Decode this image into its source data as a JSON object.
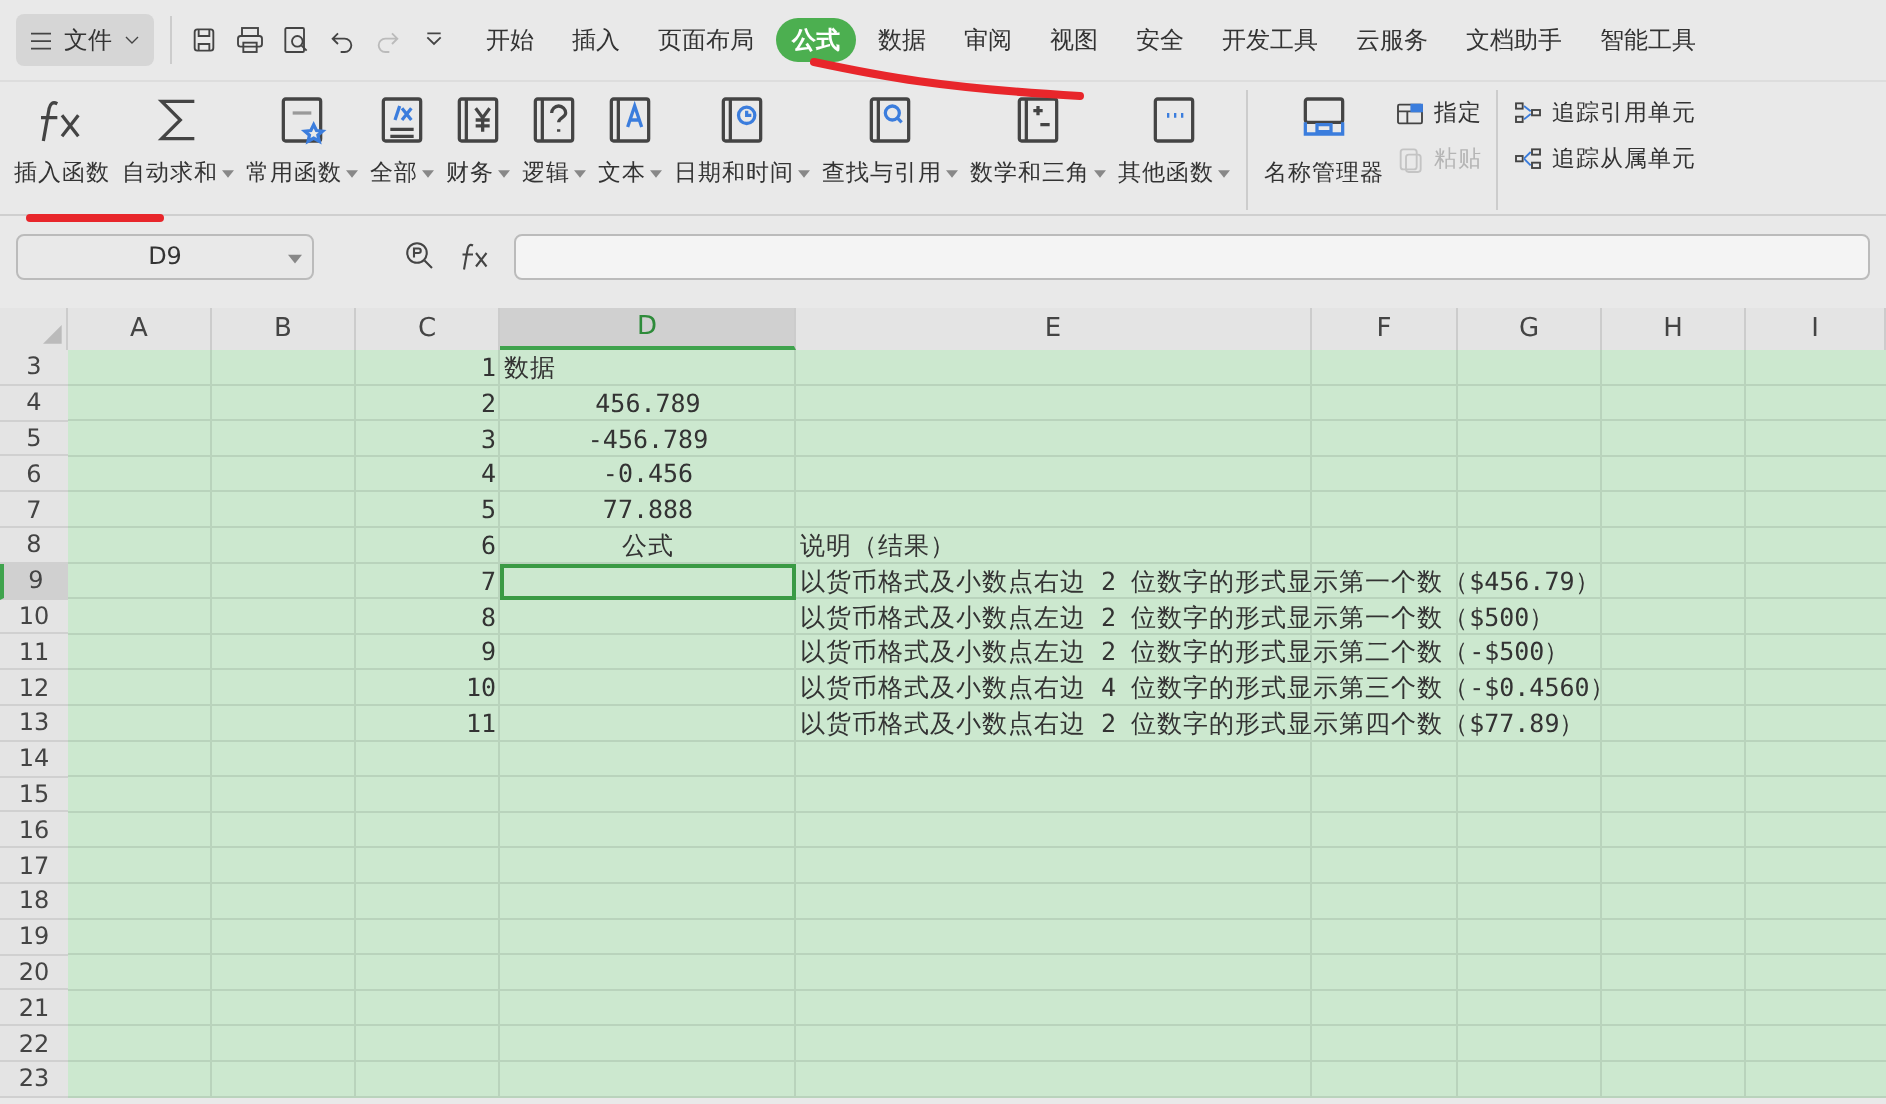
{
  "menu_button": {
    "label": "文件"
  },
  "tabs": [
    {
      "label": "开始",
      "selected": false
    },
    {
      "label": "插入",
      "selected": false
    },
    {
      "label": "页面布局",
      "selected": false
    },
    {
      "label": "公式",
      "selected": true
    },
    {
      "label": "数据",
      "selected": false
    },
    {
      "label": "审阅",
      "selected": false
    },
    {
      "label": "视图",
      "selected": false
    },
    {
      "label": "安全",
      "selected": false
    },
    {
      "label": "开发工具",
      "selected": false
    },
    {
      "label": "云服务",
      "selected": false
    },
    {
      "label": "文档助手",
      "selected": false
    },
    {
      "label": "智能工具",
      "selected": false
    }
  ],
  "ribbon": [
    {
      "kind": "large",
      "label": "插入函数",
      "dropdown": false
    },
    {
      "kind": "large",
      "label": "自动求和",
      "dropdown": true
    },
    {
      "kind": "large",
      "label": "常用函数",
      "dropdown": true
    },
    {
      "kind": "large",
      "label": "全部",
      "dropdown": true
    },
    {
      "kind": "large",
      "label": "财务",
      "dropdown": true
    },
    {
      "kind": "large",
      "label": "逻辑",
      "dropdown": true
    },
    {
      "kind": "large",
      "label": "文本",
      "dropdown": true
    },
    {
      "kind": "large",
      "label": "日期和时间",
      "dropdown": true
    },
    {
      "kind": "large",
      "label": "查找与引用",
      "dropdown": true
    },
    {
      "kind": "large",
      "label": "数学和三角",
      "dropdown": true
    },
    {
      "kind": "large",
      "label": "其他函数",
      "dropdown": true
    },
    {
      "kind": "divider"
    },
    {
      "kind": "large",
      "label": "名称管理器",
      "dropdown": false
    },
    {
      "kind": "small",
      "label": "指定",
      "disabled": false
    },
    {
      "kind": "small",
      "label": "粘贴",
      "disabled": true
    },
    {
      "kind": "divider"
    },
    {
      "kind": "small",
      "label": "追踪引用单元",
      "disabled": false
    },
    {
      "kind": "small",
      "label": "追踪从属单元",
      "disabled": false
    }
  ],
  "name_box": {
    "value": "D9"
  },
  "columns": [
    {
      "label": "A",
      "selected": false
    },
    {
      "label": "B",
      "selected": false
    },
    {
      "label": "C",
      "selected": false
    },
    {
      "label": "D",
      "selected": true
    },
    {
      "label": "E",
      "selected": false
    },
    {
      "label": "F",
      "selected": false
    },
    {
      "label": "G",
      "selected": false
    },
    {
      "label": "H",
      "selected": false
    },
    {
      "label": "I",
      "selected": false
    }
  ],
  "rows": [
    {
      "number": "3",
      "selected": false,
      "C": "1",
      "D": "数据"
    },
    {
      "number": "4",
      "selected": false,
      "C": "2",
      "D": "456.789"
    },
    {
      "number": "5",
      "selected": false,
      "C": "3",
      "D": "-456.789"
    },
    {
      "number": "6",
      "selected": false,
      "C": "4",
      "D": "-0.456"
    },
    {
      "number": "7",
      "selected": false,
      "C": "5",
      "D": "77.888"
    },
    {
      "number": "8",
      "selected": false,
      "C": "6",
      "D": "公式",
      "E": "说明（结果）"
    },
    {
      "number": "9",
      "selected": true,
      "C": "7",
      "E": "以货币格式及小数点右边 2 位数字的形式显示第一个数（$456.79）"
    },
    {
      "number": "10",
      "selected": false,
      "C": "8",
      "E": "以货币格式及小数点左边 2 位数字的形式显示第一个数（$500）"
    },
    {
      "number": "11",
      "selected": false,
      "C": "9",
      "E": "以货币格式及小数点左边 2 位数字的形式显示第二个数（-$500）"
    },
    {
      "number": "12",
      "selected": false,
      "C": "10",
      "E": "以货币格式及小数点右边 4 位数字的形式显示第三个数（-$0.4560）"
    },
    {
      "number": "13",
      "selected": false,
      "C": "11",
      "E": "以货币格式及小数点右边 2 位数字的形式显示第四个数（$77.89）"
    },
    {
      "number": "14",
      "selected": false
    },
    {
      "number": "15",
      "selected": false
    },
    {
      "number": "16",
      "selected": false
    },
    {
      "number": "17",
      "selected": false
    },
    {
      "number": "18",
      "selected": false
    },
    {
      "number": "19",
      "selected": false
    },
    {
      "number": "20",
      "selected": false
    },
    {
      "number": "21",
      "selected": false
    },
    {
      "number": "22",
      "selected": false
    },
    {
      "number": "23",
      "selected": false
    }
  ]
}
